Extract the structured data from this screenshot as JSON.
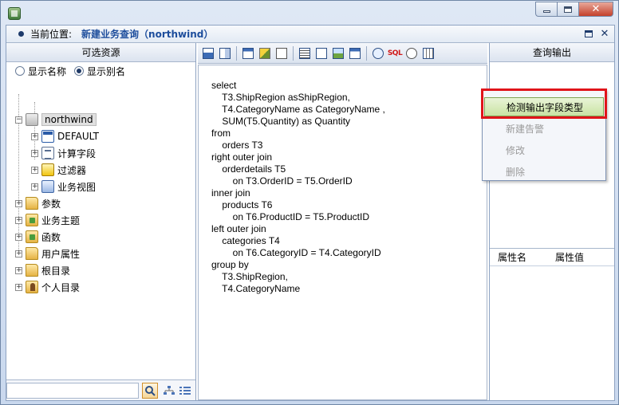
{
  "window": {
    "controls": [
      "minimize",
      "maximize",
      "close"
    ]
  },
  "location": {
    "label": "当前位置:",
    "title": "新建业务查询（northwind）"
  },
  "left_panel": {
    "header": "可选资源",
    "radio_name": "显示名称",
    "radio_alias": "显示别名",
    "selected_radio": "显示别名",
    "tree": {
      "root": "northwind",
      "children": [
        "DEFAULT",
        "计算字段",
        "过滤器",
        "业务视图"
      ],
      "top_level": [
        "参数",
        "业务主题",
        "函数",
        "用户属性",
        "根目录",
        "个人目录"
      ]
    }
  },
  "toolbar": {
    "sql_label": "SQL"
  },
  "sql_lines": [
    "select",
    "    T3.ShipRegion asShipRegion,",
    "    T4.CategoryName as CategoryName ,",
    "    SUM(T5.Quantity) as Quantity",
    "from",
    "    orders T3",
    "right outer join",
    "    orderdetails T5",
    "        on T3.OrderID = T5.OrderID",
    "inner join",
    "    products T6",
    "        on T6.ProductID = T5.ProductID",
    "left outer join",
    "    categories T4",
    "        on T6.CategoryID = T4.CategoryID",
    "group by",
    "    T3.ShipRegion,",
    "    T4.CategoryName"
  ],
  "right_panel": {
    "header": "查询输出",
    "prop_name": "属性名",
    "prop_value": "属性值"
  },
  "context_menu": {
    "items": [
      "检测输出字段类型",
      "新建告警",
      "修改",
      "删除"
    ],
    "active_index": 0
  },
  "colors": {
    "highlight_border": "#e0141a",
    "location_title": "#1d4d9c"
  }
}
